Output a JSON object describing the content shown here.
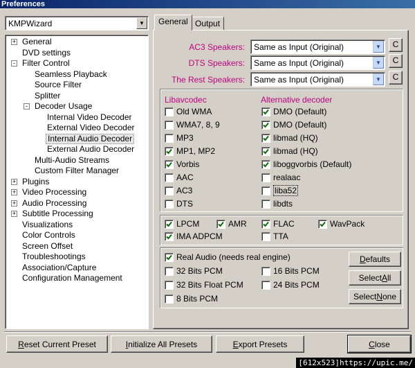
{
  "window": {
    "title": "Preferences"
  },
  "preset": {
    "value": "KMPWizard"
  },
  "tree": [
    {
      "label": "General",
      "level": 0,
      "exp": "+"
    },
    {
      "label": "DVD settings",
      "level": 0,
      "exp": ""
    },
    {
      "label": "Filter Control",
      "level": 0,
      "exp": "-"
    },
    {
      "label": "Seamless Playback",
      "level": 1,
      "exp": ""
    },
    {
      "label": "Source Filter",
      "level": 1,
      "exp": ""
    },
    {
      "label": "Splitter",
      "level": 1,
      "exp": ""
    },
    {
      "label": "Decoder Usage",
      "level": 1,
      "exp": "-"
    },
    {
      "label": "Internal Video Decoder",
      "level": 2,
      "exp": ""
    },
    {
      "label": "External Video Decoder",
      "level": 2,
      "exp": ""
    },
    {
      "label": "Internal Audio Decoder",
      "level": 2,
      "exp": "",
      "selected": true
    },
    {
      "label": "External Audio Decoder",
      "level": 2,
      "exp": ""
    },
    {
      "label": "Multi-Audio Streams",
      "level": 1,
      "exp": ""
    },
    {
      "label": "Custom Filter Manager",
      "level": 1,
      "exp": ""
    },
    {
      "label": "Plugins",
      "level": 0,
      "exp": "+"
    },
    {
      "label": "Video Processing",
      "level": 0,
      "exp": "+"
    },
    {
      "label": "Audio Processing",
      "level": 0,
      "exp": "+"
    },
    {
      "label": "Subtitle Processing",
      "level": 0,
      "exp": "+"
    },
    {
      "label": "Visualizations",
      "level": 0,
      "exp": ""
    },
    {
      "label": "Color Controls",
      "level": 0,
      "exp": ""
    },
    {
      "label": "Screen Offset",
      "level": 0,
      "exp": ""
    },
    {
      "label": "Troubleshootings",
      "level": 0,
      "exp": ""
    },
    {
      "label": "Association/Capture",
      "level": 0,
      "exp": ""
    },
    {
      "label": "Configuration Management",
      "level": 0,
      "exp": ""
    }
  ],
  "tabs": {
    "general": "General",
    "output": "Output"
  },
  "speakers": {
    "ac3": {
      "label": "AC3 Speakers:",
      "value": "Same as Input (Original)"
    },
    "dts": {
      "label": "DTS Speakers:",
      "value": "Same as Input (Original)"
    },
    "rest": {
      "label": "The Rest Speakers:",
      "value": "Same as Input (Original)"
    },
    "c_label": "C"
  },
  "libavcodec": {
    "title": "Libavcodec",
    "items": [
      {
        "label": "Old WMA",
        "checked": false
      },
      {
        "label": "WMA7, 8, 9",
        "checked": false
      },
      {
        "label": "MP3",
        "checked": false
      },
      {
        "label": "MP1, MP2",
        "checked": true
      },
      {
        "label": "Vorbis",
        "checked": true
      },
      {
        "label": "AAC",
        "checked": false
      },
      {
        "label": "AC3",
        "checked": false
      },
      {
        "label": "DTS",
        "checked": false
      }
    ]
  },
  "alternative": {
    "title": "Alternative decoder",
    "items": [
      {
        "label": "DMO (Default)",
        "checked": true
      },
      {
        "label": "DMO (Default)",
        "checked": true
      },
      {
        "label": "libmad (HQ)",
        "checked": true
      },
      {
        "label": "libmad (HQ)",
        "checked": true
      },
      {
        "label": "liboggvorbis (Default)",
        "checked": true
      },
      {
        "label": "realaac",
        "checked": false
      },
      {
        "label": "liba52",
        "checked": false,
        "focus": true
      },
      {
        "label": "libdts",
        "checked": false
      }
    ]
  },
  "formats": [
    {
      "label": "LPCM",
      "checked": true
    },
    {
      "label": "AMR",
      "checked": true
    },
    {
      "label": "FLAC",
      "checked": true
    },
    {
      "label": "WavPack",
      "checked": true
    },
    {
      "label": "IMA ADPCM",
      "checked": true
    },
    {
      "label": "TTA",
      "checked": false
    }
  ],
  "realaudio": {
    "real_label": "Real Audio (needs real engine)",
    "real_checked": true,
    "pcm": [
      {
        "label": "32 Bits PCM",
        "checked": false
      },
      {
        "label": "16 Bits PCM",
        "checked": false
      },
      {
        "label": "32 Bits Float PCM",
        "checked": false
      },
      {
        "label": "24 Bits PCM",
        "checked": false
      },
      {
        "label": "8 Bits PCM",
        "checked": false
      }
    ],
    "defaults": {
      "pre": "",
      "u": "D",
      "post": "efaults"
    },
    "select_all": {
      "pre": "Select ",
      "u": "A",
      "post": "ll"
    },
    "select_none": {
      "pre": "Select ",
      "u": "N",
      "post": "one"
    }
  },
  "footer": {
    "reset": {
      "pre": "",
      "u": "R",
      "post": "eset Current Preset"
    },
    "init": {
      "pre": "",
      "u": "I",
      "post": "nitialize All Presets"
    },
    "export": {
      "pre": "",
      "u": "E",
      "post": "xport Presets"
    },
    "close": {
      "pre": "",
      "u": "C",
      "post": "lose"
    }
  },
  "watermark": "[612x523]https://upic.me/"
}
